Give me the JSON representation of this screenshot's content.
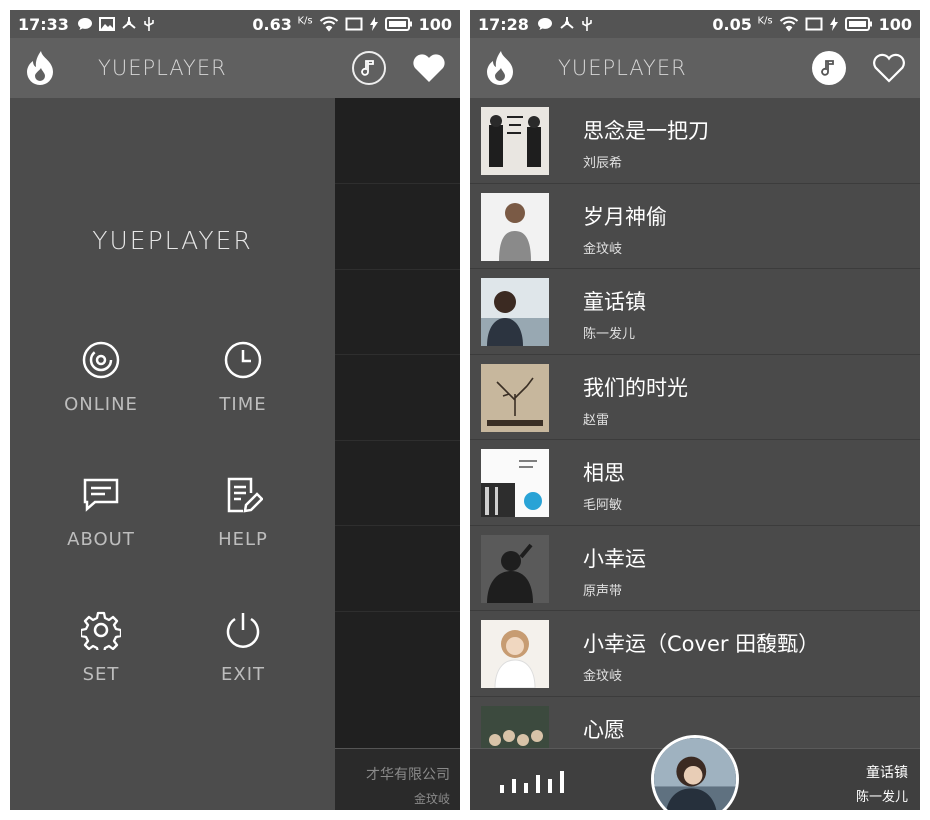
{
  "left": {
    "status": {
      "time": "17:33",
      "speed": "0.63",
      "speed_unit": "K/s",
      "battery": "100"
    },
    "appbar": {
      "title": "YUEPLAYER"
    },
    "drawer": {
      "title": "YUEPLAYER",
      "items": [
        {
          "label": "ONLINE",
          "icon": "disc-icon"
        },
        {
          "label": "TIME",
          "icon": "clock-icon"
        },
        {
          "label": "ABOUT",
          "icon": "chat-icon"
        },
        {
          "label": "HELP",
          "icon": "edit-doc-icon"
        },
        {
          "label": "SET",
          "icon": "gear-icon"
        },
        {
          "label": "EXIT",
          "icon": "power-icon"
        }
      ]
    },
    "footer": {
      "title": "才华有限公司",
      "artist": "金玟岐"
    }
  },
  "right": {
    "status": {
      "time": "17:28",
      "speed": "0.05",
      "speed_unit": "K/s",
      "battery": "100"
    },
    "appbar": {
      "title": "YUEPLAYER"
    },
    "songs": [
      {
        "title": "思念是一把刀",
        "artist": "刘辰希"
      },
      {
        "title": "岁月神偷",
        "artist": "金玟岐"
      },
      {
        "title": "童话镇",
        "artist": "陈一发儿"
      },
      {
        "title": "我们的时光",
        "artist": "赵雷"
      },
      {
        "title": "相思",
        "artist": "毛阿敏"
      },
      {
        "title": "小幸运",
        "artist": "原声带"
      },
      {
        "title": "小幸运（Cover 田馥甄）",
        "artist": "金玟岐"
      },
      {
        "title": "心愿",
        "artist": ""
      }
    ],
    "now_playing": {
      "title": "童话镇",
      "artist": "陈一发儿"
    }
  },
  "colors": {
    "appbar": "#606060",
    "statusbar": "#545454",
    "background": "#4a4a4a",
    "drawer_overlay": "#202020"
  }
}
